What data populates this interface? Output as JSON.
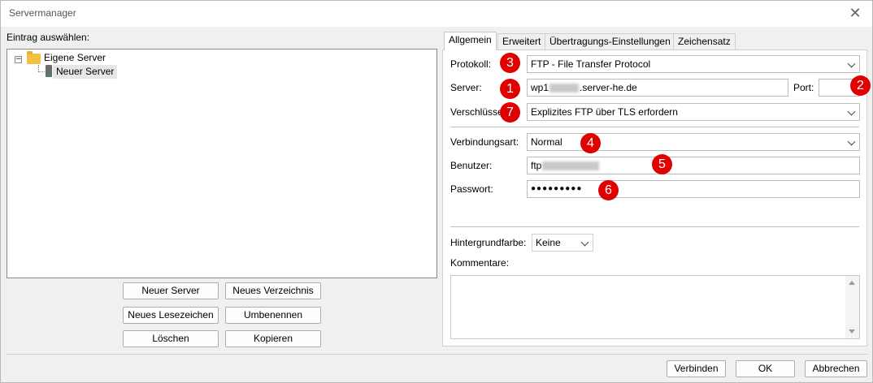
{
  "window": {
    "title": "Servermanager",
    "close_glyph": "✕"
  },
  "left": {
    "label": "Eintrag auswählen:",
    "tree": {
      "root_label": "Eigene Server",
      "expander_glyph": "−",
      "child_label": "Neuer Server"
    },
    "buttons": {
      "new_server": "Neuer Server",
      "new_folder": "Neues Verzeichnis",
      "new_bookmark": "Neues Lesezeichen",
      "rename": "Umbenennen",
      "delete": "Löschen",
      "copy": "Kopieren"
    }
  },
  "tabs": [
    {
      "label": "Allgemein",
      "active": true
    },
    {
      "label": "Erweitert"
    },
    {
      "label": "Übertragungs-Einstellungen"
    },
    {
      "label": "Zeichensatz"
    }
  ],
  "general": {
    "protocol_label": "Protokoll:",
    "protocol_value": "FTP - File Transfer Protocol",
    "server_label": "Server:",
    "server_prefix": "wp1",
    "server_suffix": ".server-he.de",
    "port_label": "Port:",
    "port_value": "",
    "encryption_label": "Verschlüssel",
    "encryption_value": "Explizites FTP über TLS erfordern",
    "logon_label": "Verbindungsart:",
    "logon_value": "Normal",
    "user_label": "Benutzer:",
    "user_prefix": "ftp",
    "password_label": "Passwort:",
    "password_value": "●●●●●●●●●",
    "bg_color_label": "Hintergrundfarbe:",
    "bg_color_value": "Keine",
    "comments_label": "Kommentare:"
  },
  "badges": [
    "1",
    "2",
    "3",
    "4",
    "5",
    "6",
    "7"
  ],
  "footer": {
    "connect": "Verbinden",
    "ok": "OK",
    "cancel": "Abbrechen"
  },
  "colors": {
    "badge": "#e00000",
    "folder": "#f4c041"
  }
}
